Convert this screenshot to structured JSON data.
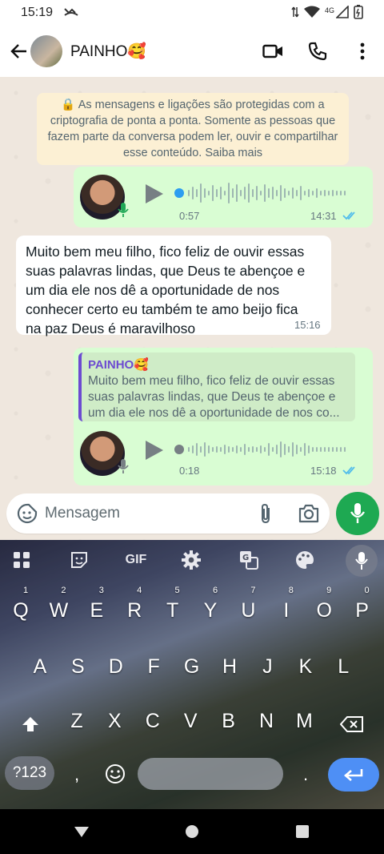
{
  "status_bar": {
    "time": "15:19",
    "network": "4G"
  },
  "header": {
    "contact_name": "PAINHO🥰"
  },
  "encryption_notice": "🔒 As mensagens e ligações são protegidas com a criptografia de ponta a ponta. Somente as pessoas que fazem parte da conversa podem ler, ouvir e compartilhar esse conteúdo. Saiba mais",
  "messages": [
    {
      "type": "voice",
      "direction": "out",
      "duration": "0:57",
      "time": "14:31",
      "progress": 0
    },
    {
      "type": "text",
      "direction": "in",
      "text": "Muito bem meu filho, fico feliz de ouvir essas suas palavras lindas, que Deus te abençoe e um dia ele nos dê a oportunidade de nos conhecer certo eu também te amo beijo fica na paz Deus é maravilhoso",
      "time": "15:16"
    },
    {
      "type": "voice",
      "direction": "out",
      "duration": "0:18",
      "time": "15:18",
      "progress": 0,
      "reply_to": {
        "name": "PAINHO🥰",
        "text": "Muito bem meu filho, fico feliz de ouvir essas suas palavras lindas, que Deus te abençoe e um dia ele nos dê a oportunidade de nos co..."
      }
    }
  ],
  "composer": {
    "placeholder": "Mensagem"
  },
  "keyboard": {
    "toolbar": {
      "gif": "GIF"
    },
    "rows": [
      [
        {
          "k": "Q",
          "n": "1"
        },
        {
          "k": "W",
          "n": "2"
        },
        {
          "k": "E",
          "n": "3"
        },
        {
          "k": "R",
          "n": "4"
        },
        {
          "k": "T",
          "n": "5"
        },
        {
          "k": "Y",
          "n": "6"
        },
        {
          "k": "U",
          "n": "7"
        },
        {
          "k": "I",
          "n": "8"
        },
        {
          "k": "O",
          "n": "9"
        },
        {
          "k": "P",
          "n": "0"
        }
      ],
      [
        {
          "k": "A"
        },
        {
          "k": "S"
        },
        {
          "k": "D"
        },
        {
          "k": "F"
        },
        {
          "k": "G"
        },
        {
          "k": "H"
        },
        {
          "k": "J"
        },
        {
          "k": "K"
        },
        {
          "k": "L"
        }
      ],
      [
        {
          "k": "Z"
        },
        {
          "k": "X"
        },
        {
          "k": "C"
        },
        {
          "k": "V"
        },
        {
          "k": "B"
        },
        {
          "k": "N"
        },
        {
          "k": "M"
        }
      ]
    ],
    "symbols_key": "?123",
    "comma": ",",
    "period": "."
  },
  "colors": {
    "outgoing_bubble": "#d9fdd3",
    "accent_green": "#1ea952",
    "read_ticks": "#53bdeb",
    "keyboard_enter": "#4e8ff5"
  }
}
